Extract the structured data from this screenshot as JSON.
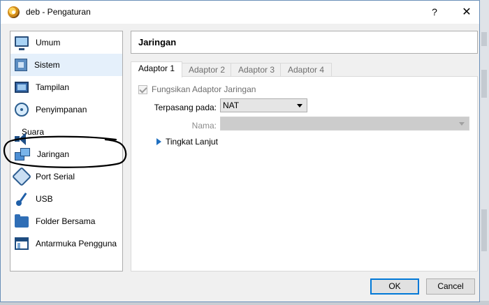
{
  "window": {
    "title": "deb - Pengaturan",
    "help_label": "?",
    "close_label": "✕",
    "icon": "virtualbox-icon"
  },
  "sidebar": {
    "selected": "Sistem",
    "items": [
      {
        "label": "Umum",
        "icon": "monitor-icon"
      },
      {
        "label": "Sistem",
        "icon": "chip-icon"
      },
      {
        "label": "Tampilan",
        "icon": "display-icon"
      },
      {
        "label": "Penyimpanan",
        "icon": "storage-icon"
      },
      {
        "label": "Suara",
        "icon": "speaker-icon"
      },
      {
        "label": "Jaringan",
        "icon": "network-icon"
      },
      {
        "label": "Port Serial",
        "icon": "serial-port-icon"
      },
      {
        "label": "USB",
        "icon": "usb-icon"
      },
      {
        "label": "Folder Bersama",
        "icon": "shared-folder-icon"
      },
      {
        "label": "Antarmuka Pengguna",
        "icon": "user-interface-icon"
      }
    ]
  },
  "header": {
    "title": "Jaringan"
  },
  "tabs": [
    {
      "label": "Adaptor 1",
      "active": true
    },
    {
      "label": "Adaptor 2",
      "active": false
    },
    {
      "label": "Adaptor 3",
      "active": false
    },
    {
      "label": "Adaptor 4",
      "active": false
    }
  ],
  "form": {
    "enable_adapter_label": "Fungsikan Adaptor Jaringan",
    "enable_adapter_checked": true,
    "attached_label": "Terpasang pada:",
    "attached_value": "NAT",
    "name_label": "Nama:",
    "name_value": "",
    "advanced_label": "Tingkat Lanjut"
  },
  "buttons": {
    "ok": "OK",
    "cancel": "Cancel"
  },
  "colors": {
    "selection": "#e5f0fb",
    "accent": "#0078d7"
  }
}
